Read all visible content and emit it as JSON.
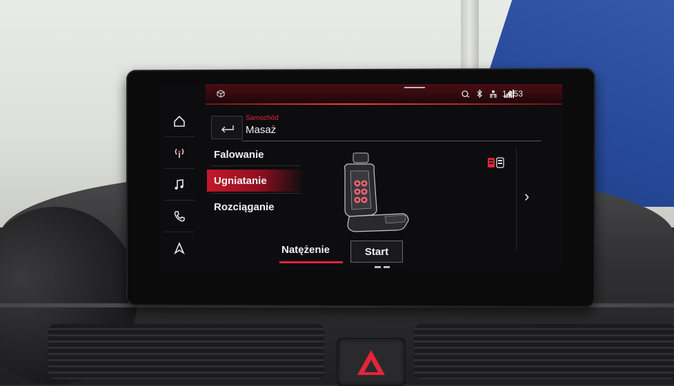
{
  "status_bar": {
    "time": "14:53",
    "icons": [
      "cube-icon",
      "location-sync-icon",
      "bluetooth-icon",
      "person-icon",
      "signal-icon"
    ]
  },
  "side_nav": {
    "items": [
      {
        "name": "home",
        "icon": "home-icon"
      },
      {
        "name": "radio",
        "icon": "radio-icon"
      },
      {
        "name": "media",
        "icon": "music-note-icon"
      },
      {
        "name": "phone",
        "icon": "phone-icon"
      },
      {
        "name": "navigation",
        "icon": "navigation-arrow-icon"
      }
    ]
  },
  "header": {
    "breadcrumb": "Samochód",
    "title": "Masaż"
  },
  "massage_programs": {
    "items": [
      {
        "label": "Falowanie",
        "selected": false
      },
      {
        "label": "Ugniatanie",
        "selected": true
      },
      {
        "label": "Rozciąganie",
        "selected": false
      }
    ]
  },
  "bottom": {
    "intensity_label": "Natężenie",
    "start_label": "Start"
  },
  "colors": {
    "accent": "#e5243b",
    "background": "#0d0d0f",
    "text": "#f2f2f2"
  }
}
